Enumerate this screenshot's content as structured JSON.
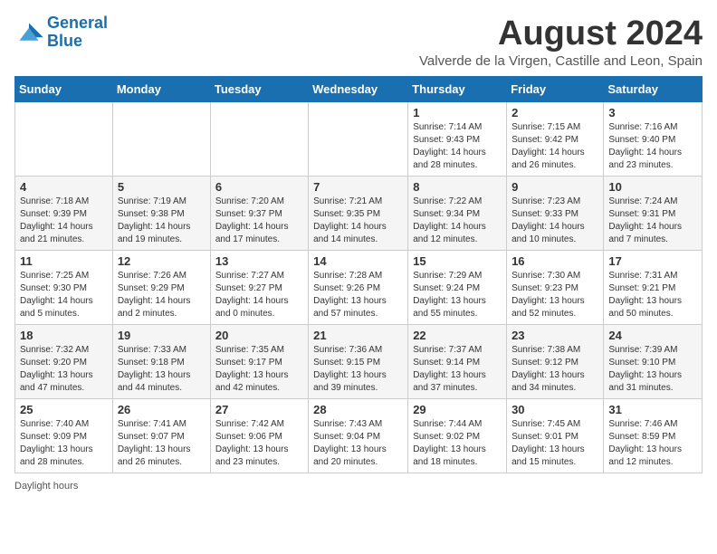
{
  "header": {
    "logo_line1": "General",
    "logo_line2": "Blue",
    "month_title": "August 2024",
    "subtitle": "Valverde de la Virgen, Castille and Leon, Spain"
  },
  "days_of_week": [
    "Sunday",
    "Monday",
    "Tuesday",
    "Wednesday",
    "Thursday",
    "Friday",
    "Saturday"
  ],
  "weeks": [
    [
      {
        "day": "",
        "info": ""
      },
      {
        "day": "",
        "info": ""
      },
      {
        "day": "",
        "info": ""
      },
      {
        "day": "",
        "info": ""
      },
      {
        "day": "1",
        "info": "Sunrise: 7:14 AM\nSunset: 9:43 PM\nDaylight: 14 hours\nand 28 minutes."
      },
      {
        "day": "2",
        "info": "Sunrise: 7:15 AM\nSunset: 9:42 PM\nDaylight: 14 hours\nand 26 minutes."
      },
      {
        "day": "3",
        "info": "Sunrise: 7:16 AM\nSunset: 9:40 PM\nDaylight: 14 hours\nand 23 minutes."
      }
    ],
    [
      {
        "day": "4",
        "info": "Sunrise: 7:18 AM\nSunset: 9:39 PM\nDaylight: 14 hours\nand 21 minutes."
      },
      {
        "day": "5",
        "info": "Sunrise: 7:19 AM\nSunset: 9:38 PM\nDaylight: 14 hours\nand 19 minutes."
      },
      {
        "day": "6",
        "info": "Sunrise: 7:20 AM\nSunset: 9:37 PM\nDaylight: 14 hours\nand 17 minutes."
      },
      {
        "day": "7",
        "info": "Sunrise: 7:21 AM\nSunset: 9:35 PM\nDaylight: 14 hours\nand 14 minutes."
      },
      {
        "day": "8",
        "info": "Sunrise: 7:22 AM\nSunset: 9:34 PM\nDaylight: 14 hours\nand 12 minutes."
      },
      {
        "day": "9",
        "info": "Sunrise: 7:23 AM\nSunset: 9:33 PM\nDaylight: 14 hours\nand 10 minutes."
      },
      {
        "day": "10",
        "info": "Sunrise: 7:24 AM\nSunset: 9:31 PM\nDaylight: 14 hours\nand 7 minutes."
      }
    ],
    [
      {
        "day": "11",
        "info": "Sunrise: 7:25 AM\nSunset: 9:30 PM\nDaylight: 14 hours\nand 5 minutes."
      },
      {
        "day": "12",
        "info": "Sunrise: 7:26 AM\nSunset: 9:29 PM\nDaylight: 14 hours\nand 2 minutes."
      },
      {
        "day": "13",
        "info": "Sunrise: 7:27 AM\nSunset: 9:27 PM\nDaylight: 14 hours\nand 0 minutes."
      },
      {
        "day": "14",
        "info": "Sunrise: 7:28 AM\nSunset: 9:26 PM\nDaylight: 13 hours\nand 57 minutes."
      },
      {
        "day": "15",
        "info": "Sunrise: 7:29 AM\nSunset: 9:24 PM\nDaylight: 13 hours\nand 55 minutes."
      },
      {
        "day": "16",
        "info": "Sunrise: 7:30 AM\nSunset: 9:23 PM\nDaylight: 13 hours\nand 52 minutes."
      },
      {
        "day": "17",
        "info": "Sunrise: 7:31 AM\nSunset: 9:21 PM\nDaylight: 13 hours\nand 50 minutes."
      }
    ],
    [
      {
        "day": "18",
        "info": "Sunrise: 7:32 AM\nSunset: 9:20 PM\nDaylight: 13 hours\nand 47 minutes."
      },
      {
        "day": "19",
        "info": "Sunrise: 7:33 AM\nSunset: 9:18 PM\nDaylight: 13 hours\nand 44 minutes."
      },
      {
        "day": "20",
        "info": "Sunrise: 7:35 AM\nSunset: 9:17 PM\nDaylight: 13 hours\nand 42 minutes."
      },
      {
        "day": "21",
        "info": "Sunrise: 7:36 AM\nSunset: 9:15 PM\nDaylight: 13 hours\nand 39 minutes."
      },
      {
        "day": "22",
        "info": "Sunrise: 7:37 AM\nSunset: 9:14 PM\nDaylight: 13 hours\nand 37 minutes."
      },
      {
        "day": "23",
        "info": "Sunrise: 7:38 AM\nSunset: 9:12 PM\nDaylight: 13 hours\nand 34 minutes."
      },
      {
        "day": "24",
        "info": "Sunrise: 7:39 AM\nSunset: 9:10 PM\nDaylight: 13 hours\nand 31 minutes."
      }
    ],
    [
      {
        "day": "25",
        "info": "Sunrise: 7:40 AM\nSunset: 9:09 PM\nDaylight: 13 hours\nand 28 minutes."
      },
      {
        "day": "26",
        "info": "Sunrise: 7:41 AM\nSunset: 9:07 PM\nDaylight: 13 hours\nand 26 minutes."
      },
      {
        "day": "27",
        "info": "Sunrise: 7:42 AM\nSunset: 9:06 PM\nDaylight: 13 hours\nand 23 minutes."
      },
      {
        "day": "28",
        "info": "Sunrise: 7:43 AM\nSunset: 9:04 PM\nDaylight: 13 hours\nand 20 minutes."
      },
      {
        "day": "29",
        "info": "Sunrise: 7:44 AM\nSunset: 9:02 PM\nDaylight: 13 hours\nand 18 minutes."
      },
      {
        "day": "30",
        "info": "Sunrise: 7:45 AM\nSunset: 9:01 PM\nDaylight: 13 hours\nand 15 minutes."
      },
      {
        "day": "31",
        "info": "Sunrise: 7:46 AM\nSunset: 8:59 PM\nDaylight: 13 hours\nand 12 minutes."
      }
    ]
  ],
  "footer": {
    "daylight_label": "Daylight hours"
  }
}
